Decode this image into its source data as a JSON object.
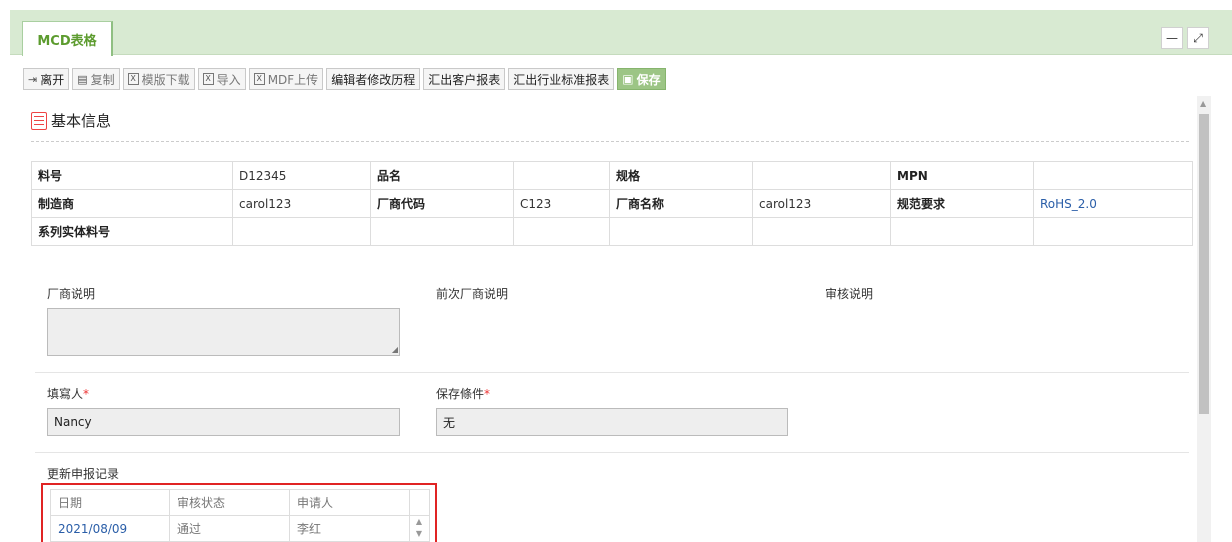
{
  "tab": {
    "title": "MCD表格"
  },
  "window_controls": {
    "minimize": "—",
    "maximize": "⤢"
  },
  "toolbar": {
    "leave": "离开",
    "copy": "复制",
    "template_download": "模版下载",
    "import": "导入",
    "mdf_upload": "MDF上传",
    "edit_history": "编辑者修改历程",
    "export_customer": "汇出客户报表",
    "export_industry": "汇出行业标准报表",
    "save": "保存"
  },
  "section": {
    "title": "基本信息"
  },
  "info_table": {
    "rows": [
      [
        "料号",
        "D12345",
        "品名",
        "",
        "规格",
        "",
        "MPN",
        ""
      ],
      [
        "制造商",
        "carol123",
        "厂商代码",
        "C123",
        "厂商名称",
        "carol123",
        "规范要求",
        "RoHS_2.0"
      ],
      [
        "系列实体料号",
        "",
        "",
        "",
        "",
        "",
        "",
        ""
      ]
    ]
  },
  "fields": {
    "vendor_note_label": "厂商说明",
    "prev_vendor_note_label": "前次厂商说明",
    "review_note_label": "审核说明",
    "filler_label": "填寫人",
    "filler_value": "Nancy",
    "storage_label": "保存條件",
    "storage_value": "无",
    "required_mark": "*"
  },
  "records": {
    "title": "更新申报记录",
    "headers": [
      "日期",
      "审核状态",
      "申请人"
    ],
    "rows": [
      [
        "2021/08/09",
        "通过",
        "李红"
      ]
    ]
  }
}
